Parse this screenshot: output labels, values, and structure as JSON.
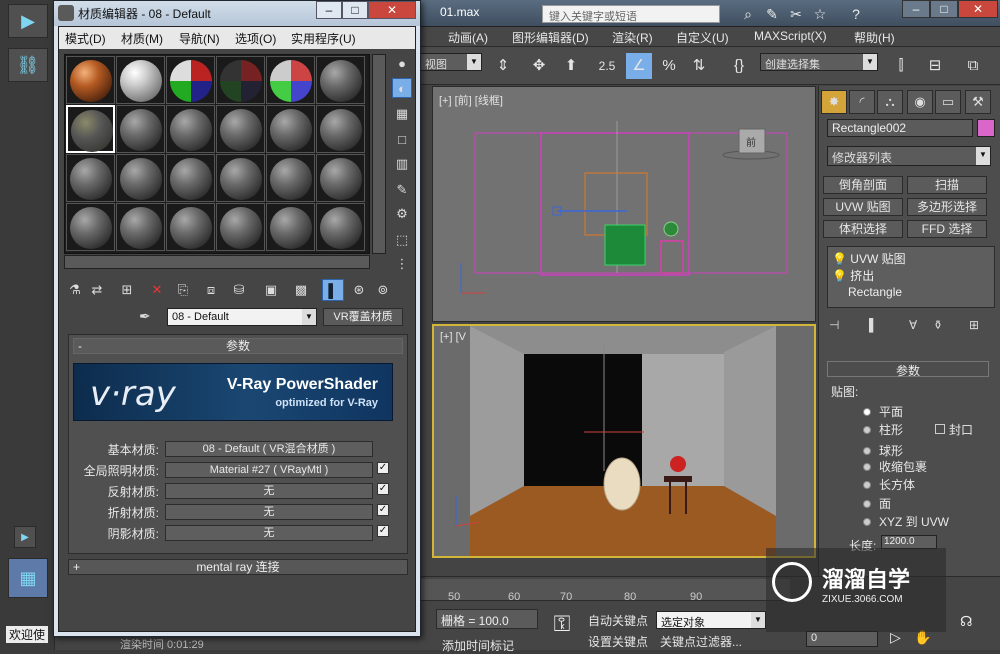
{
  "max": {
    "file_title": "01.max",
    "search_placeholder": "键入关键字或短语",
    "menu": [
      "动画(A)",
      "图形编辑器(D)",
      "渲染(R)",
      "自定义(U)",
      "MAXScript(X)",
      "帮助(H)"
    ],
    "viewport_dropdown": "视图",
    "snap_value": "2.5",
    "selection_set": "创建选择集",
    "front_label": "[+] [前] [线框]",
    "persp_label": "[+] [V",
    "view_cube_label": "前",
    "timeline_numbers": [
      "50",
      "60",
      "70",
      "80",
      "90"
    ],
    "grid_label": "栅格 = 100.0",
    "auto_key": "自动关键点",
    "select_object": "选定对象",
    "set_key": "设置关键点",
    "key_filter": "关键点过滤器...",
    "add_time_tag": "添加时间标记",
    "frame_value": "0",
    "status_left": "欢迎使",
    "status_timer": "渲染时间  0:01:29"
  },
  "command_panel": {
    "object_name": "Rectangle002",
    "modifier_list": "修改器列表",
    "buttons": [
      "倒角剖面",
      "扫描",
      "UVW 贴图",
      "多边形选择",
      "体积选择",
      "FFD 选择"
    ],
    "stack": [
      "UVW 贴图",
      "挤出",
      "Rectangle"
    ],
    "params_title": "参数",
    "mapping_label": "贴图:",
    "mapping_options": [
      "平面",
      "柱形",
      "球形",
      "收缩包裹",
      "长方体",
      "面",
      "XYZ 到 UVW"
    ],
    "cap_label": "封口",
    "length_label": "长度:",
    "length_value": "1200.0"
  },
  "material_editor": {
    "title": "材质编辑器 - 08 - Default",
    "menu": [
      "模式(D)",
      "材质(M)",
      "导航(N)",
      "选项(O)",
      "实用程序(U)"
    ],
    "material_name": "08 - Default",
    "material_type_button": "VR覆盖材质",
    "params_title": "参数",
    "vray_logo": "v·ray",
    "vray_title": "V-Ray PowerShader",
    "vray_subtitle": "optimized for V-Ray",
    "rows": [
      {
        "label": "基本材质:",
        "value": "08 - Default ( VR混合材质 )",
        "has_check": false
      },
      {
        "label": "全局照明材质:",
        "value": "Material #27 ( VRayMtl )",
        "has_check": true
      },
      {
        "label": "反射材质:",
        "value": "无",
        "has_check": true
      },
      {
        "label": "折射材质:",
        "value": "无",
        "has_check": true
      },
      {
        "label": "阴影材质:",
        "value": "无",
        "has_check": true
      }
    ],
    "mental_ray": "mental ray 连接"
  },
  "watermark": {
    "title": "溜溜自学",
    "url": "ZIXUE.3066.COM"
  }
}
